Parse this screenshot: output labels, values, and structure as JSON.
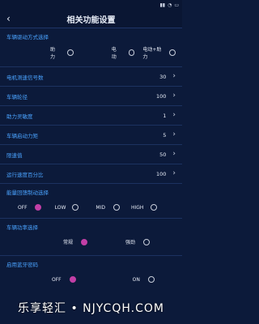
{
  "status": {
    "icons": [
      "signal-icon",
      "wifi-icon",
      "battery-icon"
    ]
  },
  "header": {
    "title": "相关功能设置"
  },
  "drive_mode": {
    "label": "车辆驱动方式选择",
    "options": [
      {
        "label": "助力",
        "selected": false
      },
      {
        "label": "电动",
        "selected": false
      },
      {
        "label": "电动+助力",
        "selected": false
      }
    ]
  },
  "rows": [
    {
      "label": "电机测速信号数",
      "value": "30"
    },
    {
      "label": "车辆轮径",
      "value": "100"
    },
    {
      "label": "助力灵敏度",
      "value": "1"
    },
    {
      "label": "车辆启动力矩",
      "value": "5"
    },
    {
      "label": "限速值",
      "value": "50"
    },
    {
      "label": "运行速度百分比",
      "value": "100"
    }
  ],
  "regen": {
    "label": "能量回馈制动选择",
    "options": [
      {
        "label": "OFF",
        "selected": true
      },
      {
        "label": "LOW",
        "selected": false
      },
      {
        "label": "MID",
        "selected": false
      },
      {
        "label": "HIGH",
        "selected": false
      }
    ]
  },
  "power": {
    "label": "车辆功率选择",
    "options": [
      {
        "label": "常规",
        "selected": true
      },
      {
        "label": "强劲",
        "selected": false
      }
    ]
  },
  "bt_pwd": {
    "label": "启用蓝牙密码",
    "options": [
      {
        "label": "OFF",
        "selected": true
      },
      {
        "label": "ON",
        "selected": false
      }
    ]
  },
  "watermark": "乐享轻汇 • NJYCQH.COM",
  "colors": {
    "accent": "#4aa3ff",
    "selected": "#c23fa6",
    "background": "#0c1a3a"
  }
}
